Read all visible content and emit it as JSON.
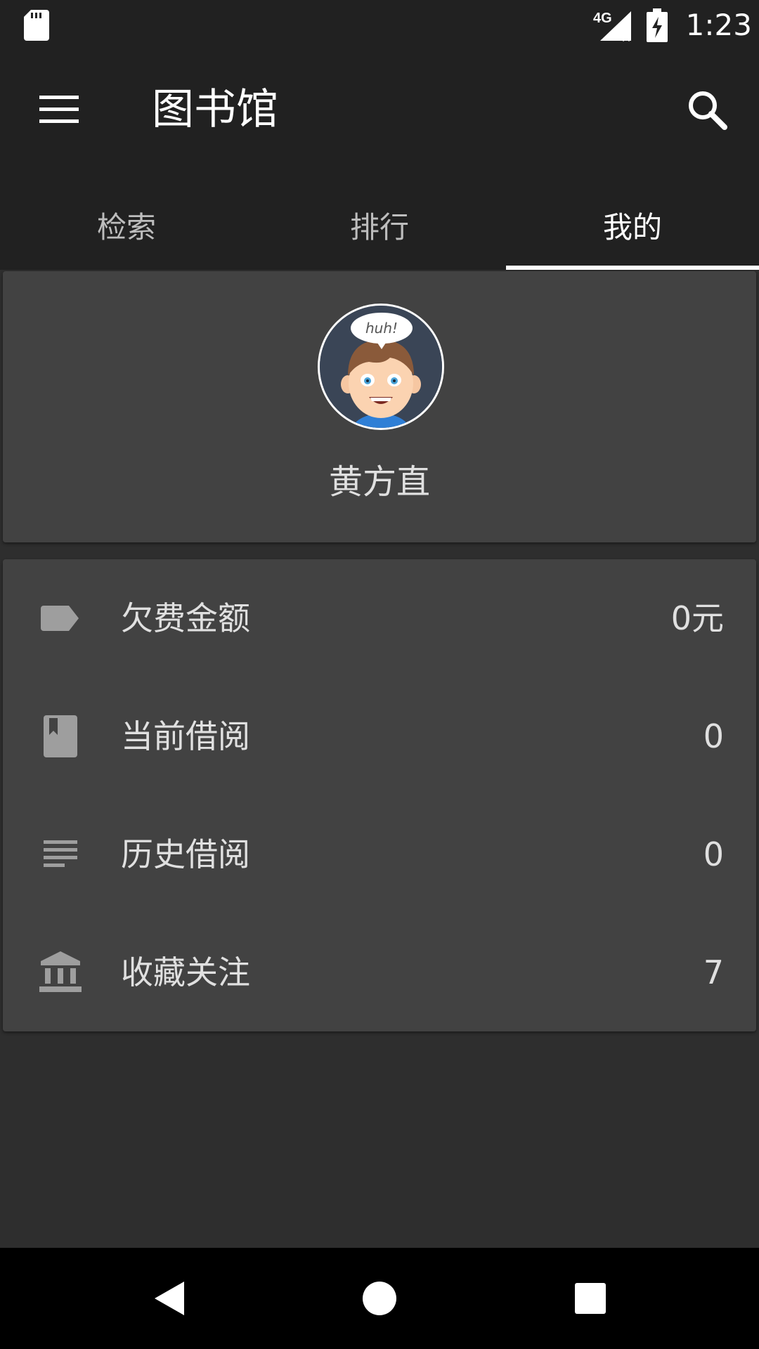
{
  "status_bar": {
    "network": "4G",
    "time": "1:23",
    "icons": [
      "sd-card-icon",
      "signal-icon",
      "battery-charging-icon"
    ]
  },
  "app_bar": {
    "title": "图书馆",
    "menu_icon": "menu-icon",
    "search_icon": "search-icon"
  },
  "tabs": [
    {
      "label": "检索",
      "active": false
    },
    {
      "label": "排行",
      "active": false
    },
    {
      "label": "我的",
      "active": true
    }
  ],
  "profile": {
    "avatar_bubble_text": "huh!",
    "name": "黄方直"
  },
  "stats": [
    {
      "icon": "label-tag-icon",
      "label": "欠费金额",
      "value": "0元"
    },
    {
      "icon": "book-bookmark-icon",
      "label": "当前借阅",
      "value": "0"
    },
    {
      "icon": "lines-list-icon",
      "label": "历史借阅",
      "value": "0"
    },
    {
      "icon": "library-building-icon",
      "label": "收藏关注",
      "value": "7"
    }
  ],
  "colors": {
    "app_bar": "#212121",
    "background": "#2e2e2e",
    "card": "#424242",
    "icon_grey": "#9e9e9e"
  },
  "nav_bar": [
    "back-icon",
    "home-icon",
    "recents-icon"
  ]
}
